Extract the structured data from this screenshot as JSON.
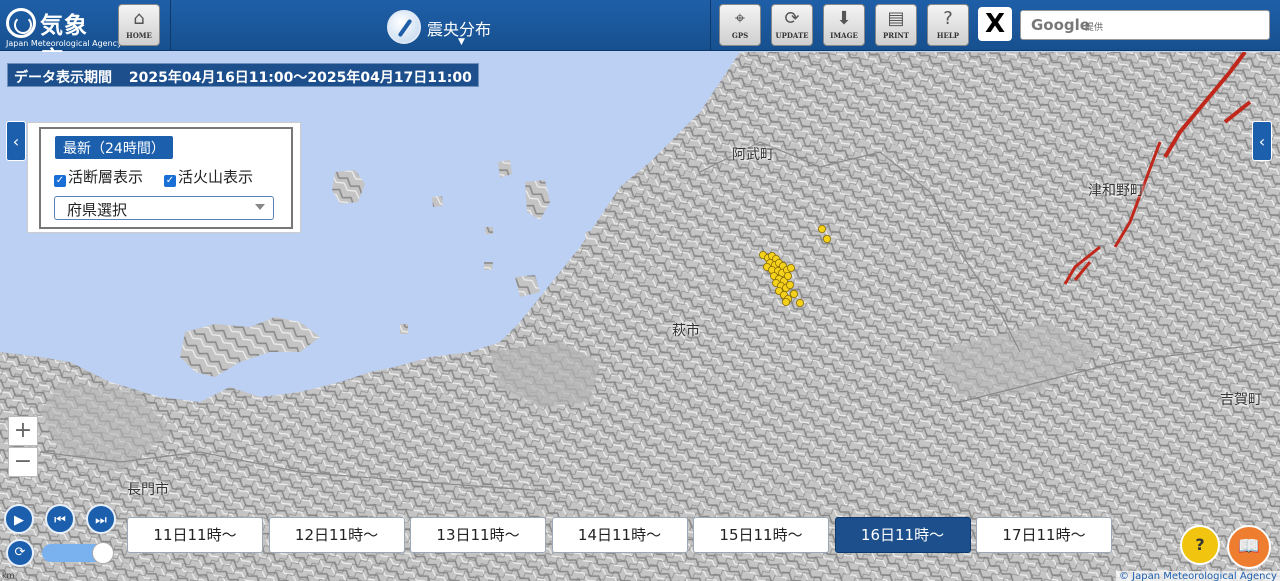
{
  "header": {
    "logo_jp": "気象庁",
    "logo_en": "Japan Meteorological Agency",
    "home_label": "HOME",
    "title": "震央分布",
    "buttons": [
      {
        "label": "GPS"
      },
      {
        "label": "UPDATE"
      },
      {
        "label": "IMAGE"
      },
      {
        "label": "PRINT"
      },
      {
        "label": "HELP"
      }
    ],
    "x_label": "X",
    "search_brand": "Google",
    "search_sub": "提供"
  },
  "period": {
    "label": "データ表示期間",
    "value": "2025年04月16日11:00～2025年04月17日11:00"
  },
  "panel": {
    "latest": "最新（24時間）",
    "active_fault": "活断層表示",
    "active_volcano": "活火山表示",
    "prefecture_select": "府県選択"
  },
  "map": {
    "places": [
      {
        "name": "阿武町"
      },
      {
        "name": "津和野町"
      },
      {
        "name": "萩市"
      },
      {
        "name": "吉賀町"
      },
      {
        "name": "長門市"
      }
    ],
    "epicenter_color": "#f4d21c",
    "fault_color": "#c0281c"
  },
  "zoom": {
    "in": "+",
    "out": "−"
  },
  "scale_label": "km",
  "days": [
    {
      "label": "11日11時〜",
      "active": false
    },
    {
      "label": "12日11時〜",
      "active": false
    },
    {
      "label": "13日11時〜",
      "active": false
    },
    {
      "label": "14日11時〜",
      "active": false
    },
    {
      "label": "15日11時〜",
      "active": false
    },
    {
      "label": "16日11時〜",
      "active": true
    },
    {
      "label": "17日11時〜",
      "active": false
    }
  ],
  "copyright": "© Japan Meteorological Agency"
}
